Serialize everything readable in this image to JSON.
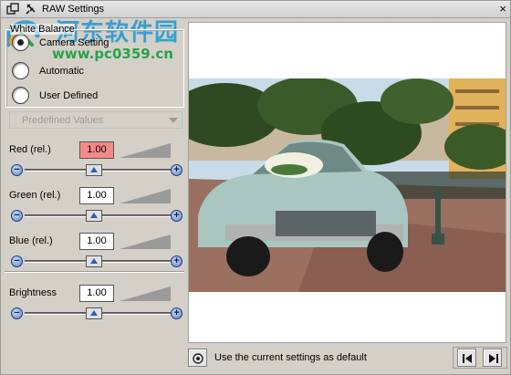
{
  "window": {
    "title": "RAW Settings",
    "close_glyph": "×"
  },
  "watermark": {
    "text_cn": "河东软件园",
    "url": "www.pc0359.cn"
  },
  "white_balance": {
    "title": "White Balance",
    "options": [
      {
        "label": "Camera Setting",
        "selected": true
      },
      {
        "label": "Automatic",
        "selected": false
      },
      {
        "label": "User Defined",
        "selected": false
      }
    ]
  },
  "predefined": {
    "label": "Predefined Values",
    "disabled": true
  },
  "sliders": [
    {
      "label": "Red (rel.)",
      "value": "1.00",
      "active": true,
      "level": 0.5
    },
    {
      "label": "Green (rel.)",
      "value": "1.00",
      "active": false,
      "level": 0.5
    },
    {
      "label": "Blue (rel.)",
      "value": "1.00",
      "active": false,
      "level": 0.5
    },
    {
      "label": "Brightness",
      "value": "1.00",
      "active": false,
      "level": 0.5
    }
  ],
  "minus_glyph": "−",
  "plus_glyph": "+",
  "footer": {
    "default_label": "Use the current settings as default"
  },
  "icons": {
    "window": "restore-icon",
    "pin": "pin-icon",
    "default": "target-icon",
    "first": "skip-first-icon",
    "last": "skip-last-icon"
  },
  "colors": {
    "active_value": "#f28a8a",
    "accent": "#2d5fb0"
  }
}
